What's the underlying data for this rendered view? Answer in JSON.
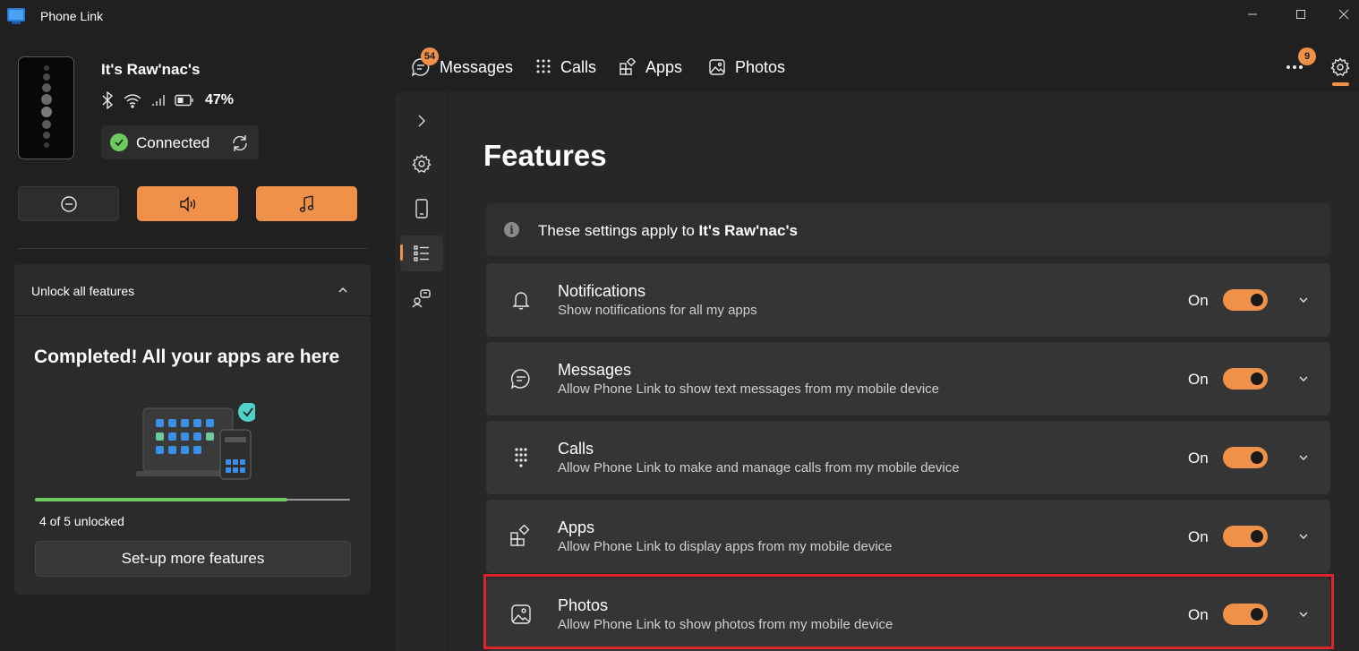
{
  "app": {
    "title": "Phone Link",
    "window_controls": [
      "minimize-icon",
      "maximize-icon",
      "close-icon"
    ]
  },
  "device": {
    "name": "It's Raw'nac's",
    "status_icons": [
      "bluetooth-icon",
      "wifi-icon",
      "signal-icon",
      "battery-icon"
    ],
    "battery": "47%",
    "connection_status": "Connected"
  },
  "quick_actions": [
    {
      "icon": "do-not-disturb-icon",
      "active": false
    },
    {
      "icon": "volume-icon",
      "active": true
    },
    {
      "icon": "music-icon",
      "active": true
    }
  ],
  "unlock": {
    "title": "Unlock all features",
    "completed_text": "Completed! All your apps are here",
    "progress_text": "4 of 5 unlocked",
    "progress_fraction": 0.8,
    "setup_button": "Set-up more features"
  },
  "nav": {
    "messages": {
      "label": "Messages",
      "badge": "54"
    },
    "calls": {
      "label": "Calls"
    },
    "apps": {
      "label": "Apps"
    },
    "photos": {
      "label": "Photos"
    },
    "more_badge": "9"
  },
  "settings_rail": [
    "chevron-right-icon",
    "gear-icon",
    "phone-icon",
    "features-list-icon",
    "personalization-icon"
  ],
  "page": {
    "title": "Features",
    "info_prefix": "These settings apply to ",
    "info_device": "It's Raw'nac's"
  },
  "features": [
    {
      "name": "Notifications",
      "description": "Show notifications for all my apps",
      "state": "On",
      "icon": "bell-icon"
    },
    {
      "name": "Messages",
      "description": "Allow Phone Link to show text messages from my mobile device",
      "state": "On",
      "icon": "chat-icon"
    },
    {
      "name": "Calls",
      "description": "Allow Phone Link to make and manage calls from my mobile device",
      "state": "On",
      "icon": "dialpad-icon"
    },
    {
      "name": "Apps",
      "description": "Allow Phone Link to display apps from my mobile device",
      "state": "On",
      "icon": "apps-icon"
    },
    {
      "name": "Photos",
      "description": "Allow Phone Link to show photos from my mobile device",
      "state": "On",
      "icon": "photo-icon"
    }
  ],
  "colors": {
    "accent": "#f0914a",
    "background": "#202020",
    "card": "#353535",
    "success": "#6ccb5f",
    "highlight": "#d9262c"
  }
}
